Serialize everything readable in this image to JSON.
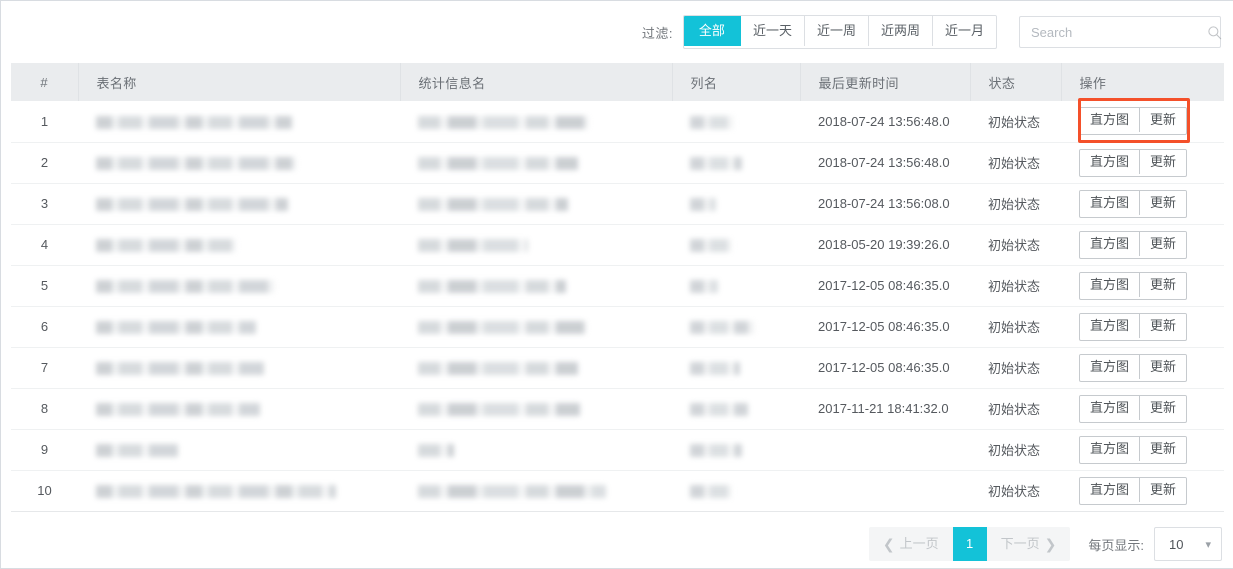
{
  "toolbar": {
    "filter_label": "过滤:",
    "filters": [
      {
        "label": "全部",
        "active": true
      },
      {
        "label": "近一天",
        "active": false
      },
      {
        "label": "近一周",
        "active": false
      },
      {
        "label": "近两周",
        "active": false
      },
      {
        "label": "近一月",
        "active": false
      }
    ],
    "search": {
      "value": "",
      "placeholder": "Search",
      "icon": "search-icon"
    }
  },
  "table": {
    "columns": [
      {
        "key": "index",
        "label": "#"
      },
      {
        "key": "table_name",
        "label": "表名称"
      },
      {
        "key": "stat_info_name",
        "label": "统计信息名"
      },
      {
        "key": "column_name",
        "label": "列名"
      },
      {
        "key": "last_update_time",
        "label": "最后更新时间"
      },
      {
        "key": "status",
        "label": "状态"
      },
      {
        "key": "actions",
        "label": "操作"
      }
    ],
    "action_labels": {
      "histogram": "直方图",
      "update": "更新"
    },
    "rows": [
      {
        "index": "1",
        "table_name": "",
        "stat_info_name": "",
        "column_name": "",
        "last_update_time": "2018-07-24 13:56:48.0",
        "status": "初始状态",
        "highlighted": true
      },
      {
        "index": "2",
        "table_name": "",
        "stat_info_name": "",
        "column_name": "",
        "last_update_time": "2018-07-24 13:56:48.0",
        "status": "初始状态",
        "highlighted": false
      },
      {
        "index": "3",
        "table_name": "",
        "stat_info_name": "",
        "column_name": "",
        "last_update_time": "2018-07-24 13:56:08.0",
        "status": "初始状态",
        "highlighted": false
      },
      {
        "index": "4",
        "table_name": "",
        "stat_info_name": "",
        "column_name": "",
        "last_update_time": "2018-05-20 19:39:26.0",
        "status": "初始状态",
        "highlighted": false
      },
      {
        "index": "5",
        "table_name": "",
        "stat_info_name": "",
        "column_name": "",
        "last_update_time": "2017-12-05 08:46:35.0",
        "status": "初始状态",
        "highlighted": false
      },
      {
        "index": "6",
        "table_name": "",
        "stat_info_name": "",
        "column_name": "",
        "last_update_time": "2017-12-05 08:46:35.0",
        "status": "初始状态",
        "highlighted": false
      },
      {
        "index": "7",
        "table_name": "",
        "stat_info_name": "",
        "column_name": "",
        "last_update_time": "2017-12-05 08:46:35.0",
        "status": "初始状态",
        "highlighted": false
      },
      {
        "index": "8",
        "table_name": "",
        "stat_info_name": "",
        "column_name": "",
        "last_update_time": "2017-11-21 18:41:32.0",
        "status": "初始状态",
        "highlighted": false
      },
      {
        "index": "9",
        "table_name": "",
        "stat_info_name": "",
        "column_name": "",
        "last_update_time": "",
        "status": "初始状态",
        "highlighted": false
      },
      {
        "index": "10",
        "table_name": "",
        "stat_info_name": "",
        "column_name": "",
        "last_update_time": "",
        "status": "初始状态",
        "highlighted": false
      }
    ]
  },
  "pagination": {
    "prev_label": "上一页",
    "next_label": "下一页",
    "current_page": "1",
    "per_page_label": "每页显示:",
    "per_page_value": "10"
  },
  "colors": {
    "accent": "#13c2d8",
    "highlight": "#f4502a",
    "header_bg": "#eaecee"
  }
}
